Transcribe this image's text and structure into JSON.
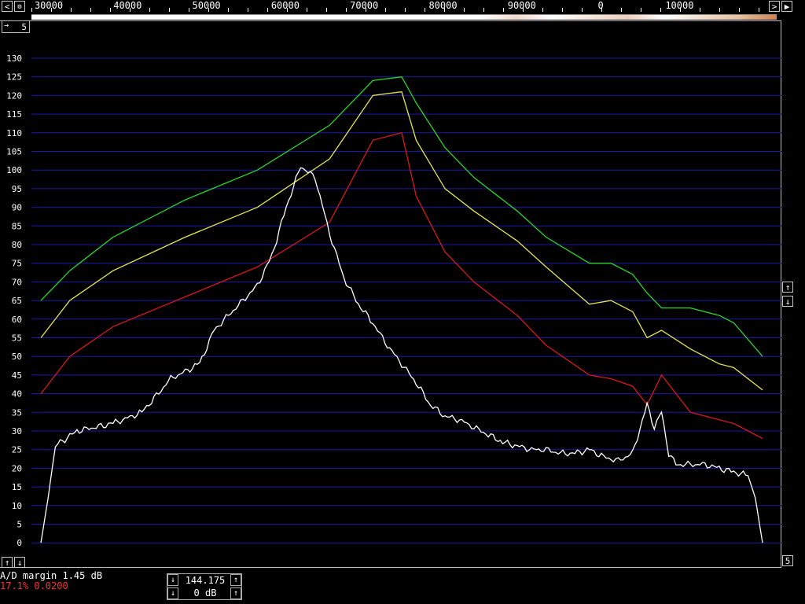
{
  "ruler": {
    "labels": [
      "30000",
      "40000",
      "50000",
      "60000",
      "70000",
      "80000",
      "90000",
      "0",
      "10000"
    ],
    "left_button": "<",
    "right_button": ">",
    "gear_glyph": "⚙"
  },
  "corner": {
    "text": "5"
  },
  "y_axis": {
    "labels": [
      "130",
      "125",
      "120",
      "115",
      "110",
      "105",
      "100",
      "95",
      "90",
      "85",
      "80",
      "75",
      "70",
      "65",
      "60",
      "55",
      "50",
      "45",
      "40",
      "35",
      "30",
      "25",
      "20",
      "15",
      "10",
      "5",
      "0"
    ]
  },
  "side_controls": {
    "up": "↑",
    "down": "↓",
    "bottom_right": "5"
  },
  "colors": {
    "grid": "#1a1aa8",
    "green": "#2bd52b",
    "yellow": "#e6e650",
    "red": "#d81818",
    "white": "#ffffff",
    "status_red": "#ff3030"
  },
  "status": {
    "ad_margin": "A/D margin 1.45 dB",
    "percent": "17.1% 0.0200"
  },
  "freq_box": {
    "frequency": "144.175",
    "gain": "0 dB"
  },
  "chart_data": {
    "type": "line",
    "ylim": [
      -5,
      135
    ],
    "series": [
      {
        "color": "#2bd52b",
        "x": [
          0,
          4,
          10,
          20,
          30,
          40,
          46,
          50,
          52,
          56,
          60,
          66,
          70,
          76,
          79,
          82,
          84,
          86,
          90,
          94,
          96,
          100
        ],
        "y": [
          65,
          73,
          82,
          92,
          100,
          112,
          124,
          125,
          118,
          106,
          98,
          89,
          82,
          75,
          75,
          72,
          67,
          63,
          63,
          61,
          59,
          50
        ]
      },
      {
        "color": "#e6e650",
        "x": [
          0,
          4,
          10,
          20,
          30,
          40,
          46,
          50,
          52,
          56,
          60,
          66,
          70,
          76,
          79,
          82,
          84,
          86,
          90,
          94,
          96,
          100
        ],
        "y": [
          55,
          65,
          73,
          82,
          90,
          103,
          120,
          121,
          108,
          95,
          89,
          81,
          74,
          64,
          65,
          62,
          55,
          57,
          52,
          48,
          47,
          41
        ]
      },
      {
        "color": "#d81818",
        "x": [
          0,
          4,
          10,
          20,
          30,
          40,
          46,
          50,
          52,
          56,
          60,
          66,
          70,
          76,
          79,
          82,
          84,
          86,
          90,
          94,
          96,
          100
        ],
        "y": [
          40,
          50,
          58,
          66,
          74,
          86,
          108,
          110,
          93,
          78,
          70,
          61,
          53,
          45,
          44,
          42,
          37,
          45,
          35,
          33,
          32,
          28
        ]
      },
      {
        "color": "#ffffff",
        "x": [
          0,
          1,
          2,
          5,
          10,
          14,
          18,
          22,
          24,
          26,
          28,
          30,
          32,
          34,
          36,
          38,
          40,
          42,
          44,
          46,
          48,
          50,
          52,
          54,
          56,
          58,
          60,
          62,
          64,
          66,
          68,
          70,
          72,
          74,
          76,
          78,
          80,
          82,
          84,
          85,
          86,
          87,
          88,
          90,
          92,
          94,
          96,
          98,
          99,
          100
        ],
        "y": [
          0,
          12,
          26,
          30,
          32,
          35,
          44,
          48,
          57,
          61,
          65,
          69,
          77,
          90,
          101,
          98,
          83,
          71,
          64,
          59,
          53,
          48,
          43,
          37,
          34,
          33,
          31,
          29,
          27,
          26,
          25,
          25,
          24,
          24,
          25,
          23,
          22,
          24,
          37,
          31,
          35,
          24,
          21,
          21,
          21,
          20,
          19,
          18,
          12,
          0
        ]
      }
    ]
  }
}
